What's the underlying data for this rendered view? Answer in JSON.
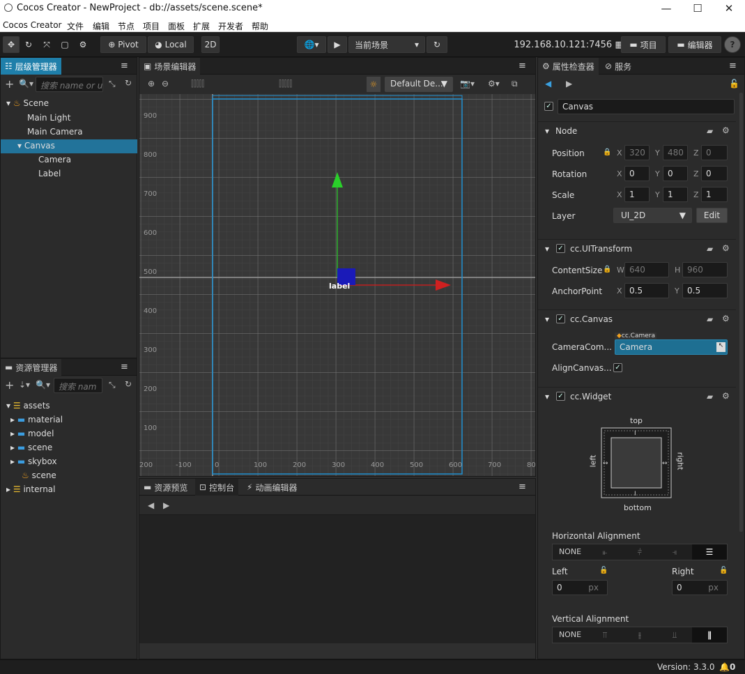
{
  "window": {
    "title": "Cocos Creator - NewProject - db://assets/scene.scene*",
    "minimize": "—",
    "maximize": "☐",
    "close": "✕"
  },
  "menu": [
    "Cocos Creator",
    "文件",
    "编辑",
    "节点",
    "项目",
    "面板",
    "扩展",
    "开发者",
    "帮助"
  ],
  "toolbar": {
    "pivot": "Pivot",
    "local": "Local",
    "mode2d": "2D",
    "scene_select": "当前场景",
    "ip": "192.168.10.121:7456",
    "project_btn": "项目",
    "editor_btn": "编辑器",
    "help": "?"
  },
  "hierarchy": {
    "tab": "层级管理器",
    "search_placeholder": "搜索 name or u",
    "items": [
      {
        "label": "Scene",
        "expanded": true
      },
      {
        "label": "Main Light"
      },
      {
        "label": "Main Camera"
      },
      {
        "label": "Canvas",
        "selected": true
      },
      {
        "label": "Camera"
      },
      {
        "label": "Label"
      }
    ]
  },
  "assets": {
    "tab": "资源管理器",
    "search_placeholder": "搜索 nam",
    "items": [
      "assets",
      "material",
      "model",
      "scene",
      "skybox",
      "scene",
      "internal"
    ]
  },
  "scene_editor": {
    "tab": "场景编辑器",
    "design": "Default De...",
    "canvas_label": "label",
    "y_ticks": [
      "900",
      "800",
      "700",
      "600",
      "500",
      "400",
      "300",
      "200",
      "100"
    ],
    "x_ticks": [
      "200",
      "-100",
      "0",
      "100",
      "200",
      "300",
      "400",
      "500",
      "600",
      "700",
      "80"
    ]
  },
  "bottom": {
    "tabs": [
      "资源预览",
      "控制台",
      "动画编辑器"
    ]
  },
  "inspector": {
    "tabs": [
      "属性检查器",
      "服务"
    ],
    "node_name": "Canvas",
    "node": {
      "title": "Node",
      "position": {
        "label": "Position",
        "x": "320",
        "y": "480",
        "z": "0"
      },
      "rotation": {
        "label": "Rotation",
        "x": "0",
        "y": "0",
        "z": "0"
      },
      "scale": {
        "label": "Scale",
        "x": "1",
        "y": "1",
        "z": "1"
      },
      "layer": {
        "label": "Layer",
        "value": "UI_2D",
        "edit": "Edit"
      }
    },
    "uitransform": {
      "title": "cc.UITransform",
      "content_size": {
        "label": "ContentSize",
        "w": "640",
        "h": "960"
      },
      "anchor": {
        "label": "AnchorPoint",
        "x": "0.5",
        "y": "0.5"
      }
    },
    "canvas": {
      "title": "cc.Canvas",
      "camera_label": "CameraCom...",
      "camera_tag": "cc.Camera",
      "camera_value": "Camera",
      "align_label": "AlignCanvas..."
    },
    "widget": {
      "title": "cc.Widget",
      "top": "top",
      "bottom": "bottom",
      "left": "left",
      "right": "right",
      "h_align": "Horizontal Alignment",
      "none": "NONE",
      "left_label": "Left",
      "right_label": "Right",
      "left_val": "0",
      "right_val": "0",
      "unit": "px",
      "v_align": "Vertical Alignment"
    },
    "axis": {
      "x": "X",
      "y": "Y",
      "z": "Z",
      "w": "W",
      "h": "H"
    }
  },
  "status": {
    "version": "Version: 3.3.0",
    "notifications": "0"
  }
}
